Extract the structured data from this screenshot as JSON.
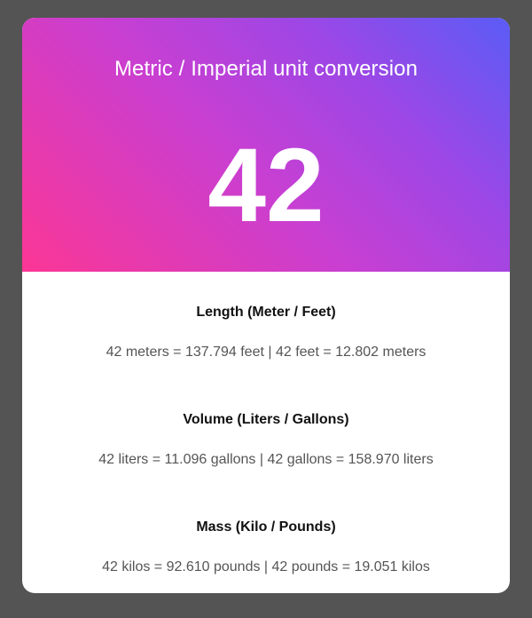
{
  "header": {
    "title": "Metric / Imperial unit conversion",
    "value": "42"
  },
  "sections": [
    {
      "title": "Length (Meter / Feet)",
      "text": "42 meters = 137.794 feet | 42 feet = 12.802 meters"
    },
    {
      "title": "Volume (Liters / Gallons)",
      "text": "42 liters = 11.096 gallons | 42 gallons = 158.970 liters"
    },
    {
      "title": "Mass (Kilo / Pounds)",
      "text": "42 kilos = 92.610 pounds | 42 pounds = 19.051 kilos"
    }
  ],
  "colors": {
    "background": "#545454",
    "gradient_start": "#fb3695",
    "gradient_end": "#5b5cf6",
    "card": "#ffffff"
  }
}
